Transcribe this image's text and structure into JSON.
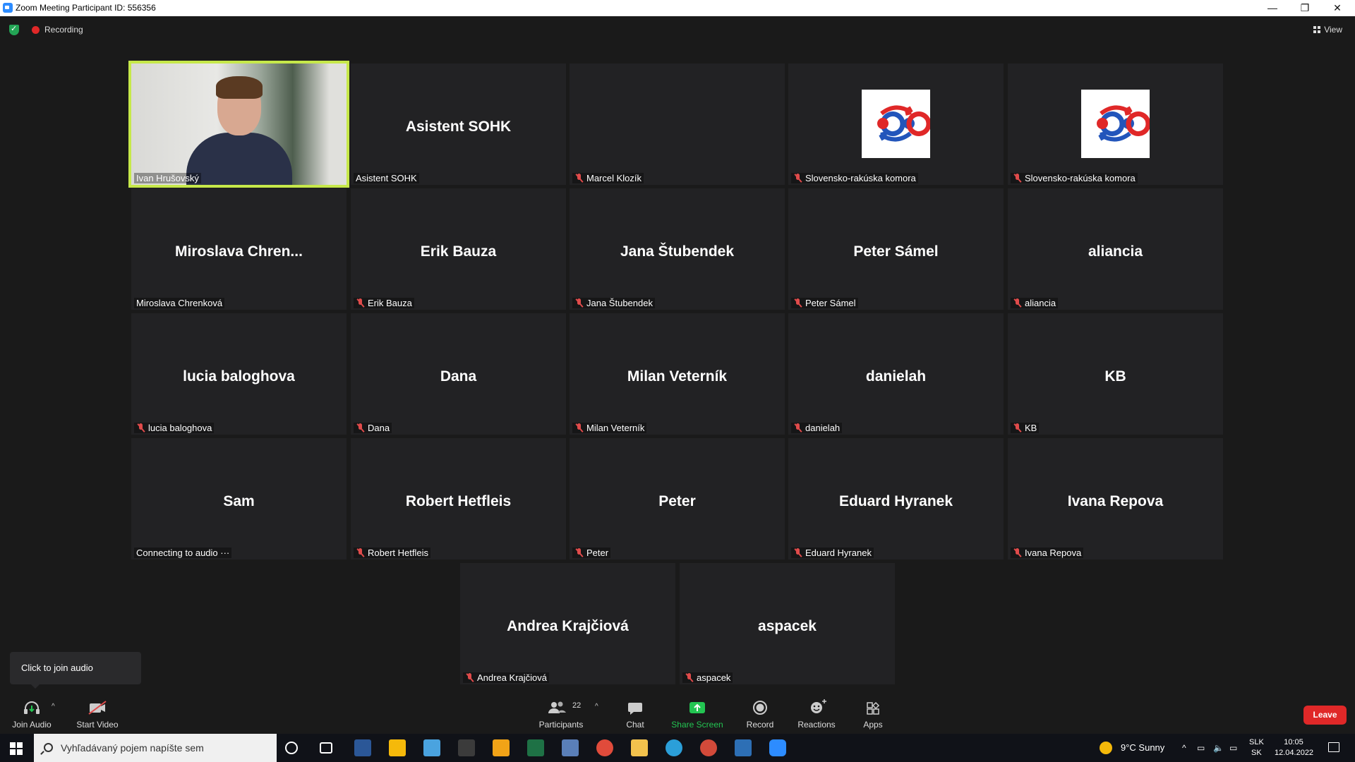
{
  "window": {
    "title": "Zoom Meeting Participant ID: 556356",
    "minimize": "—",
    "restore": "❐",
    "close": "✕"
  },
  "top": {
    "recording": "Recording",
    "view": "View"
  },
  "tiles": [
    {
      "big": "",
      "label": "Ivan Hrušovský",
      "muted": false,
      "video": true
    },
    {
      "big": "Asistent SOHK",
      "label": "Asistent SOHK",
      "muted": false
    },
    {
      "big": "",
      "label": "Marcel Klozík",
      "muted": true
    },
    {
      "big": "",
      "label": "Slovensko-rakúska komora",
      "muted": true,
      "logo": true
    },
    {
      "big": "",
      "label": "Slovensko-rakúska komora",
      "muted": true,
      "logo": true
    },
    {
      "big": "Miroslava  Chren...",
      "label": "Miroslava Chrenková",
      "muted": false
    },
    {
      "big": "Erik Bauza",
      "label": "Erik Bauza",
      "muted": true
    },
    {
      "big": "Jana Štubendek",
      "label": "Jana Štubendek",
      "muted": true
    },
    {
      "big": "Peter Sámel",
      "label": "Peter Sámel",
      "muted": true
    },
    {
      "big": "aliancia",
      "label": "aliancia",
      "muted": true
    },
    {
      "big": "lucia baloghova",
      "label": "lucia baloghova",
      "muted": true
    },
    {
      "big": "Dana",
      "label": "Dana",
      "muted": true
    },
    {
      "big": "Milan Veterník",
      "label": "Milan Veterník",
      "muted": true
    },
    {
      "big": "danielah",
      "label": "danielah",
      "muted": true
    },
    {
      "big": "KB",
      "label": "KB",
      "muted": true
    },
    {
      "big": "Sam",
      "label": "Connecting to audio ···",
      "muted": false
    },
    {
      "big": "Robert Hetfleis",
      "label": "Robert Hetfleis",
      "muted": true
    },
    {
      "big": "Peter",
      "label": "Peter",
      "muted": true
    },
    {
      "big": "Eduard Hyranek",
      "label": "Eduard Hyranek",
      "muted": true
    },
    {
      "big": "Ivana Repova",
      "label": "Ivana Repova",
      "muted": true
    },
    {
      "big": "Andrea Krajčiová",
      "label": "Andrea Krajčiová",
      "muted": true
    },
    {
      "big": "aspacek",
      "label": "aspacek",
      "muted": true
    }
  ],
  "tooltip": "Click to join audio",
  "toolbar": {
    "join_audio": "Join Audio",
    "start_video": "Start Video",
    "participants": "Participants",
    "participants_count": "22",
    "chat": "Chat",
    "share_screen": "Share Screen",
    "record": "Record",
    "reactions": "Reactions",
    "apps": "Apps",
    "leave": "Leave",
    "caret": "^"
  },
  "taskbar": {
    "search_placeholder": "Vyhľadávaný pojem napíšte sem",
    "weather": "9°C  Sunny",
    "lang_top": "SLK",
    "lang_bottom": "SK",
    "time": "10:05",
    "date": "12.04.2022"
  },
  "colors": {
    "active_speaker": "#c6e84a",
    "leave": "#e02828",
    "share": "#23c552"
  }
}
